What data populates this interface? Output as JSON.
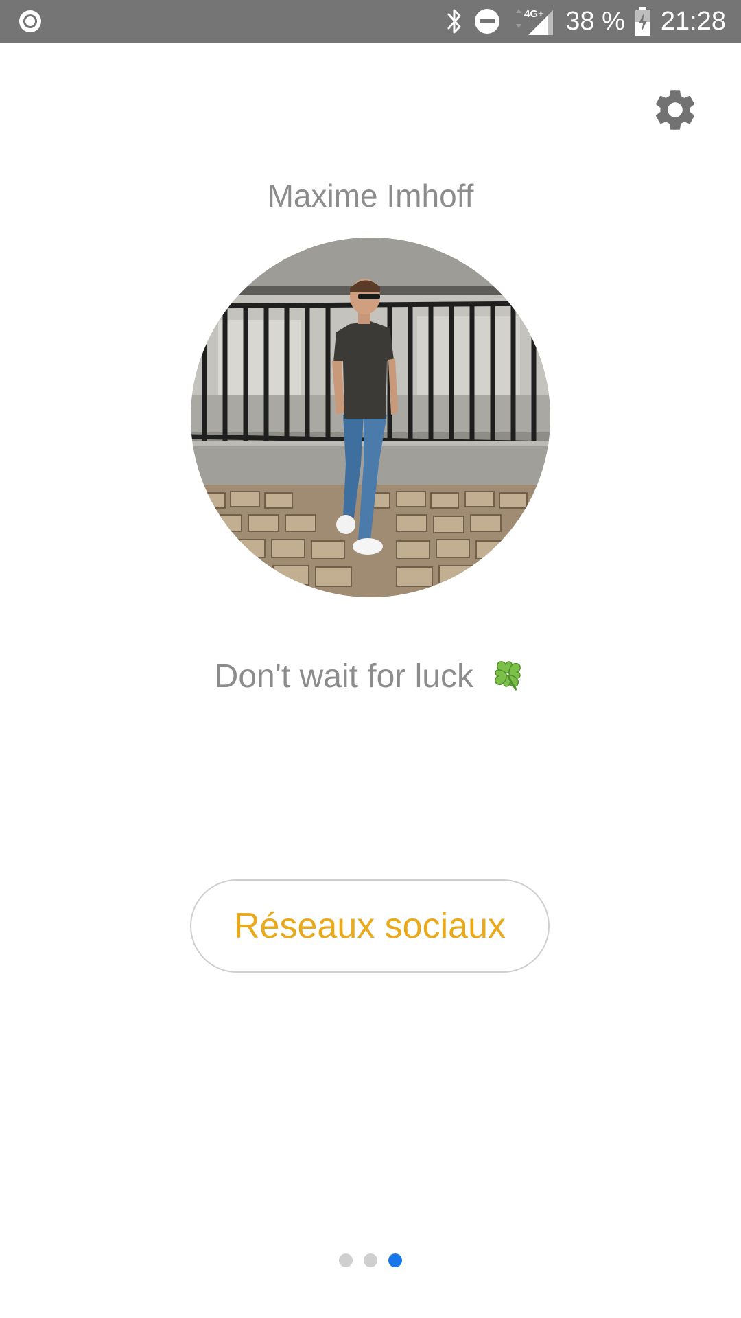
{
  "status_bar": {
    "network": "4G+",
    "battery": "38 %",
    "time": "21:28",
    "icons": [
      "record-icon",
      "bluetooth-icon",
      "do-not-disturb-icon",
      "signal-icon",
      "battery-charging-icon"
    ]
  },
  "profile": {
    "name": "Maxime Imhoff",
    "tagline": "Don't wait for luck",
    "tagline_emoji": "four-leaf-clover-icon"
  },
  "actions": {
    "social_button_label": "Réseaux sociaux",
    "settings_icon": "gear-icon"
  },
  "pager": {
    "total": 3,
    "current": 3
  },
  "colors": {
    "status_bar": "#757575",
    "text_gray": "#8c8c8c",
    "accent": "#e9a91b",
    "pager_active": "#1877e8",
    "pager_inactive": "#cfcfcf"
  }
}
